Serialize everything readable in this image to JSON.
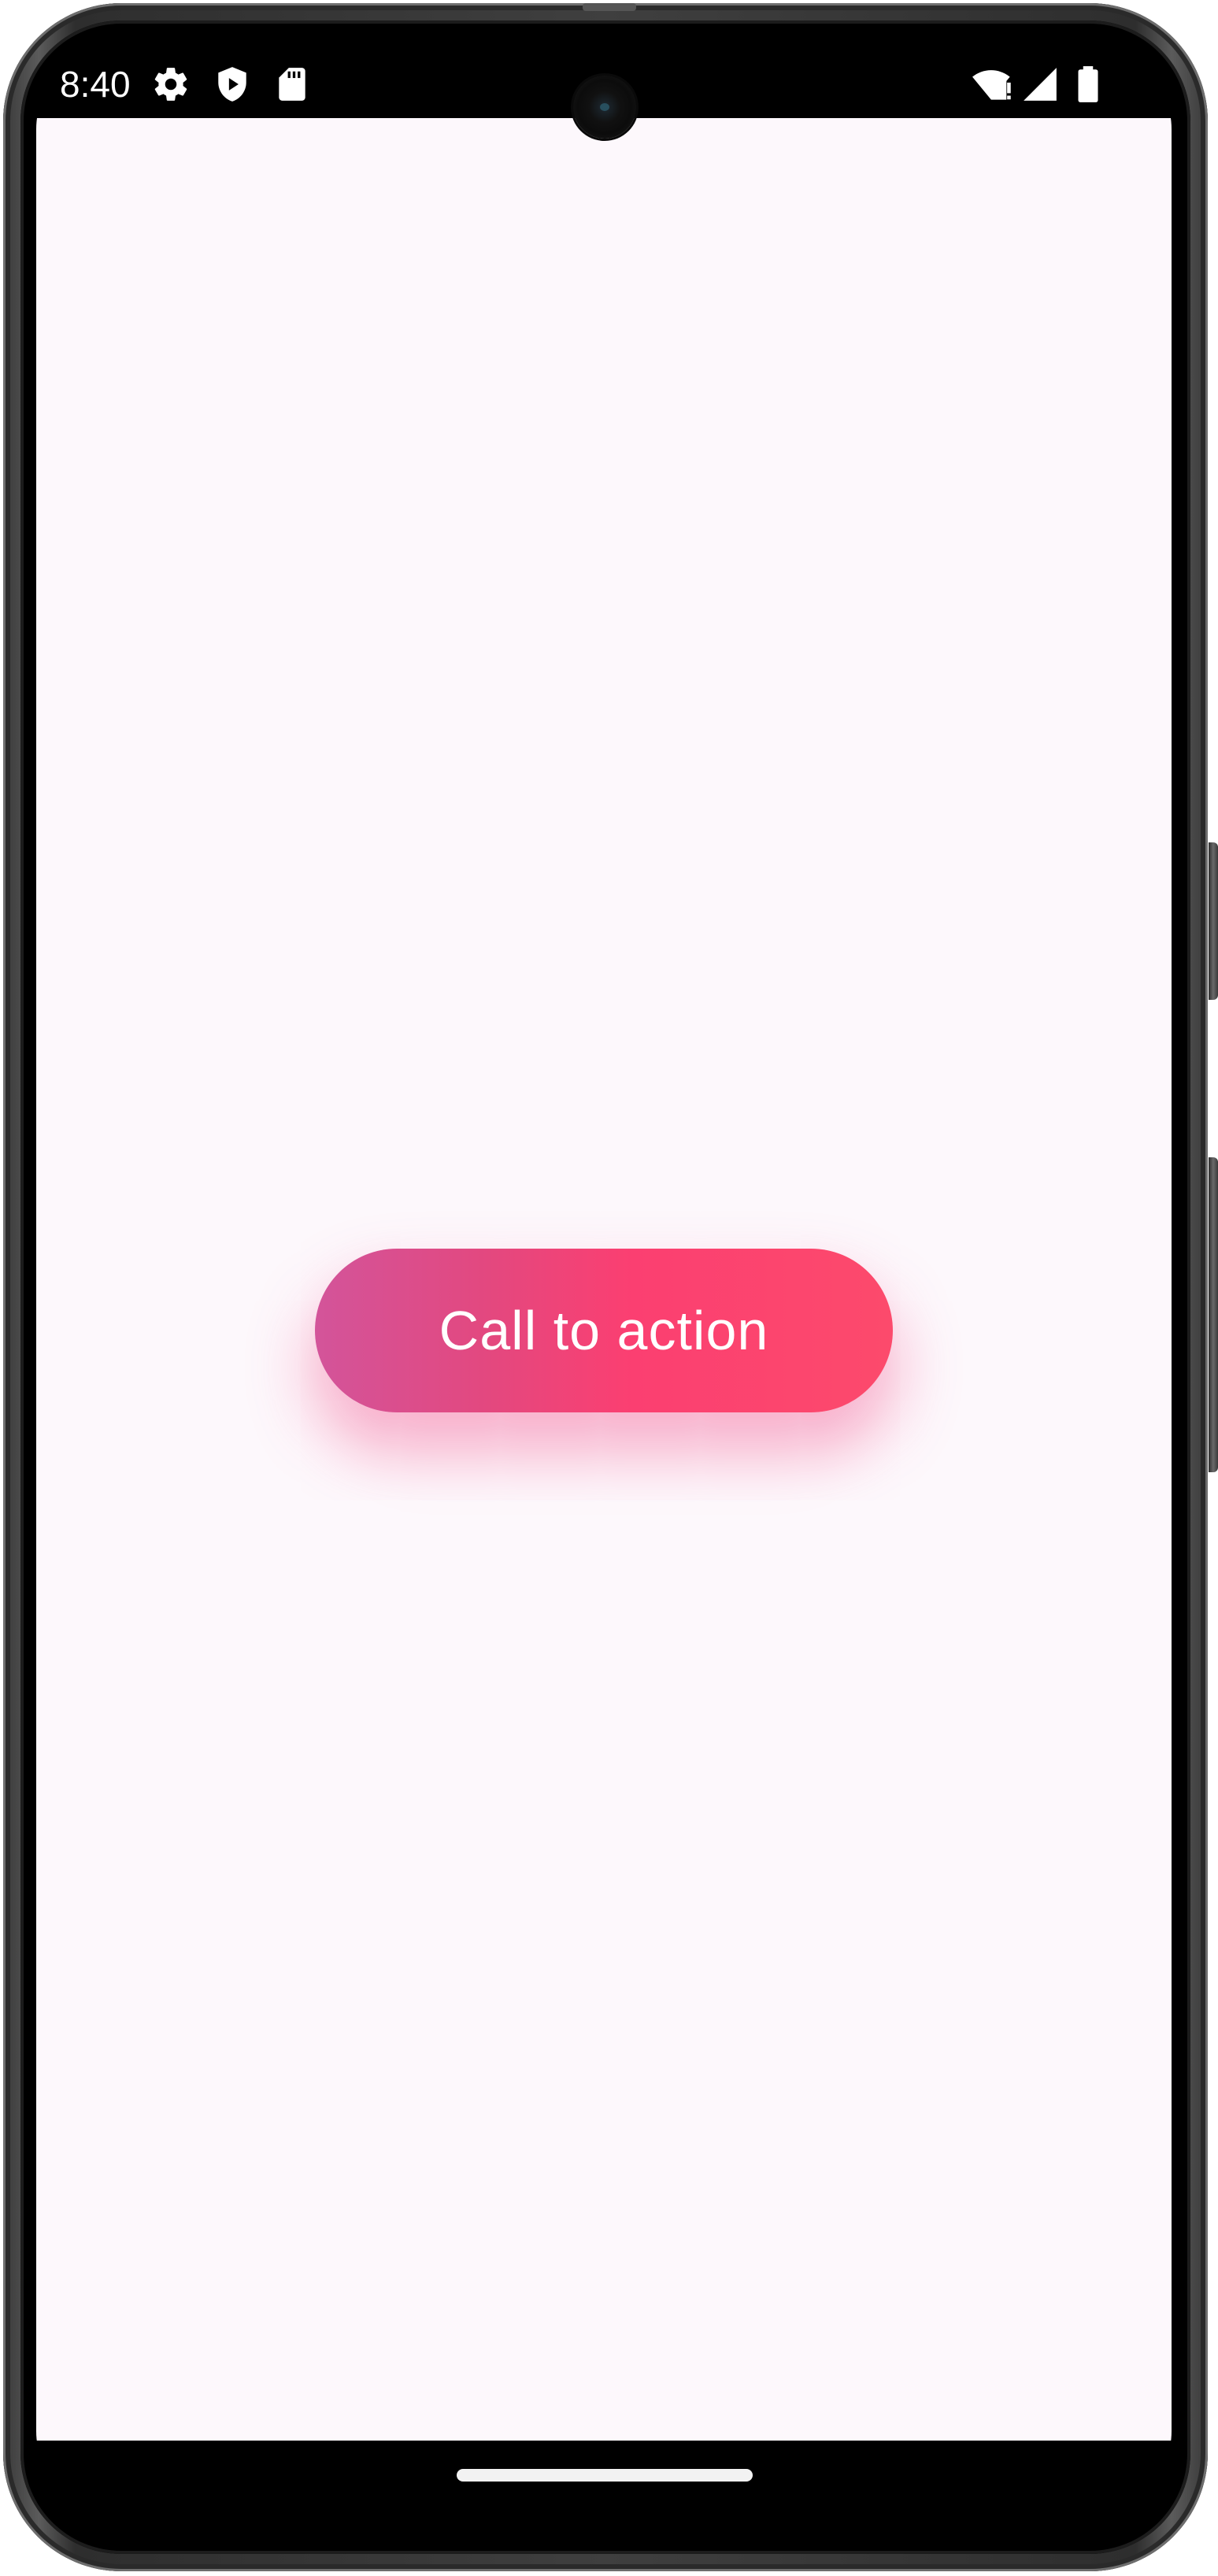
{
  "status_bar": {
    "time": "8:40",
    "left_icons": [
      "gear-icon",
      "shield-play-icon",
      "sd-card-icon"
    ],
    "right_icons": [
      "wifi-alert-icon",
      "cellular-signal-icon",
      "battery-icon"
    ]
  },
  "app": {
    "background": "#fdf8fc",
    "cta_button": {
      "label": "Call to action",
      "gradient": [
        "#d3549a",
        "#fb3f71",
        "#fc4a6c"
      ]
    }
  },
  "navigation": {
    "home_indicator": "home-indicator"
  }
}
